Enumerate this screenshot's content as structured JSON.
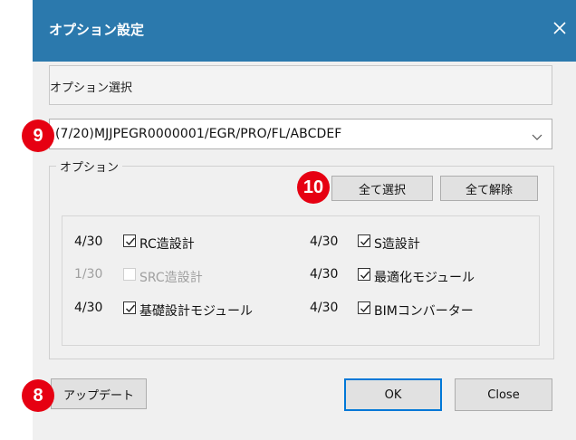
{
  "dialog": {
    "title": "オプション設定",
    "close_icon": "close-icon",
    "selection_label": "オプション選択",
    "combo_value": "(7/20)MJJPEGR0000001/EGR/PRO/FL/ABCDEF",
    "group_title": "オプション",
    "buttons": {
      "select_all": "全て選択",
      "clear_all": "全て解除",
      "update": "アップデート",
      "ok": "OK",
      "close": "Close"
    },
    "options": [
      {
        "count": "4/30",
        "label": "RC造設計",
        "checked": true,
        "enabled": true
      },
      {
        "count": "1/30",
        "label": "SRC造設計",
        "checked": false,
        "enabled": false
      },
      {
        "count": "4/30",
        "label": "基礎設計モジュール",
        "checked": true,
        "enabled": true
      },
      {
        "count": "4/30",
        "label": "S造設計",
        "checked": true,
        "enabled": true
      },
      {
        "count": "4/30",
        "label": "最適化モジュール",
        "checked": true,
        "enabled": true
      },
      {
        "count": "4/30",
        "label": "BIMコンバーター",
        "checked": true,
        "enabled": true
      }
    ]
  },
  "badges": {
    "combo": "9",
    "select_all": "10",
    "update": "8"
  },
  "colors": {
    "titlebar": "#2b79ad",
    "badge": "#e60012",
    "primary_border": "#0078d7"
  }
}
